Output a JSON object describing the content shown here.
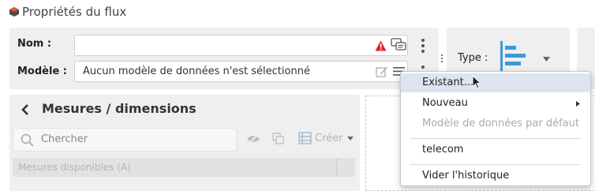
{
  "window": {
    "title": "Propriétés du flux"
  },
  "form": {
    "name_label": "Nom :",
    "name_value": "",
    "model_label": "Modèle :",
    "model_value": "Aucun modèle de données n'est sélectionné"
  },
  "type_panel": {
    "label": "Type :"
  },
  "measures": {
    "title": "Mesures / dimensions",
    "search_placeholder": "Chercher",
    "create_label": "Créer",
    "available_header": "Mesures disponibles (A)"
  },
  "menu": {
    "items": [
      {
        "label": "Existant...",
        "state": "hovered"
      },
      {
        "label": "Nouveau",
        "state": "submenu"
      },
      {
        "label": "Modèle de données par défaut",
        "state": "disabled"
      },
      {
        "label": "telecom",
        "state": "normal"
      },
      {
        "label": "Vider l'historique",
        "state": "normal"
      }
    ]
  },
  "colors": {
    "accent": "#3a9bd9",
    "warning": "#e02020",
    "menu_hover": "#dde4f0",
    "panel_bg": "#efefef",
    "app_icon": "#e05a2a"
  }
}
